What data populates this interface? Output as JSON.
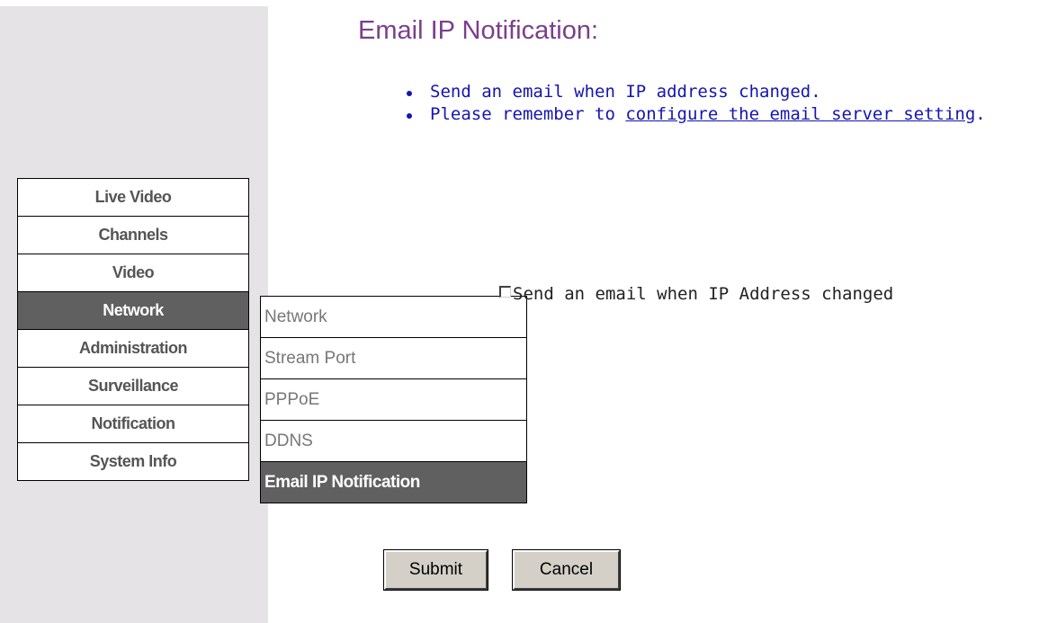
{
  "sidebar": {
    "items": [
      {
        "label": "Live Video"
      },
      {
        "label": "Channels"
      },
      {
        "label": "Video"
      },
      {
        "label": "Network",
        "active": true
      },
      {
        "label": "Administration"
      },
      {
        "label": "Surveillance"
      },
      {
        "label": "Notification"
      },
      {
        "label": "System Info"
      }
    ]
  },
  "submenu": {
    "items": [
      {
        "label": "Network"
      },
      {
        "label": "Stream Port"
      },
      {
        "label": "PPPoE"
      },
      {
        "label": "DDNS"
      },
      {
        "label": "Email IP Notification",
        "active": true
      }
    ]
  },
  "main": {
    "title": "Email IP Notification:",
    "info": {
      "line1": "Send an email when IP address changed.",
      "line2_prefix": "Please remember to ",
      "line2_link": "configure the email server setting",
      "line2_suffix": "."
    },
    "option": {
      "label": "Send an email when IP Address changed",
      "checked": false
    },
    "buttons": {
      "submit": "Submit",
      "cancel": "Cancel"
    }
  },
  "colors": {
    "title": "#7b3f8c",
    "info_text": "#1515b0",
    "sidebar_bg": "#e6e3e6",
    "active_bg": "#606060"
  }
}
